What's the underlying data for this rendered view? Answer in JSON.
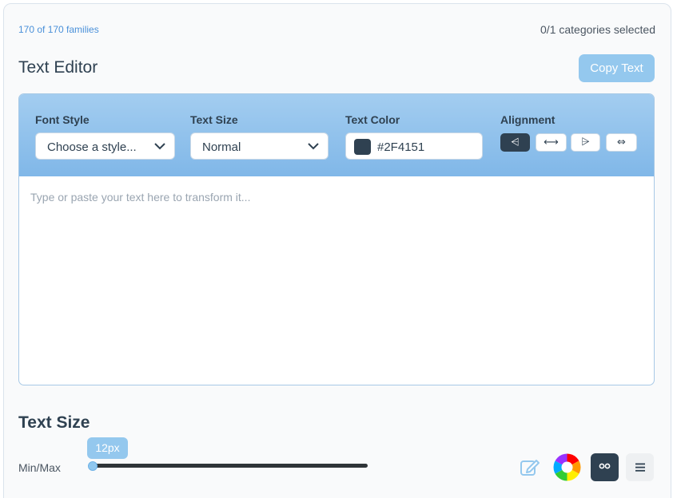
{
  "header": {
    "families_count": "170 of 170 families",
    "categories_selected": "0/1 categories selected"
  },
  "editor": {
    "title": "Text Editor",
    "copy_label": "Copy Text",
    "toolbar": {
      "font_style_label": "Font Style",
      "font_style_value": "Choose a style...",
      "text_size_label": "Text Size",
      "text_size_value": "Normal",
      "text_color_label": "Text Color",
      "text_color_value": "#2F4151",
      "alignment_label": "Alignment",
      "alignment_options": [
        {
          "icon": "align-left-icon",
          "glyph": "⩤",
          "active": true
        },
        {
          "icon": "align-center-icon",
          "glyph": "⟷",
          "active": false
        },
        {
          "icon": "align-right-icon",
          "glyph": "⩥",
          "active": false
        },
        {
          "icon": "align-justify-icon",
          "glyph": "⇔",
          "active": false
        }
      ]
    },
    "placeholder": "Type or paste your text here to transform it..."
  },
  "text_size_section": {
    "title": "Text Size",
    "range_label": "Min/Max",
    "current_value": "12px",
    "slider_fraction": 0.0
  },
  "bottom_tools": {
    "icons": [
      "edit-icon",
      "color-wheel-icon",
      "eyes-icon",
      "menu-icon"
    ]
  },
  "colors": {
    "accent": "#94c8ee",
    "link": "#4a90d9",
    "dark": "#2f4151",
    "toolbar_top": "#a3cdf0",
    "toolbar_bottom": "#80b7e8"
  }
}
